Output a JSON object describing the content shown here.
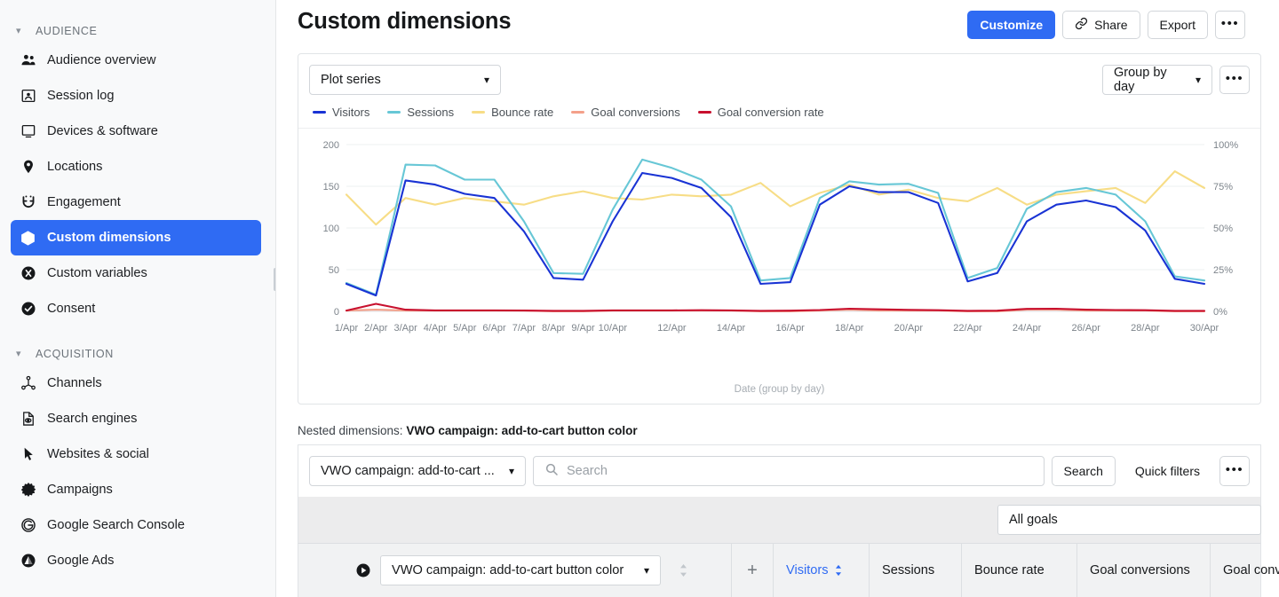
{
  "sidebar": {
    "groups": [
      {
        "name": "AUDIENCE",
        "items": [
          {
            "label": "Audience overview",
            "icon": "users-icon"
          },
          {
            "label": "Session log",
            "icon": "session-log-icon"
          },
          {
            "label": "Devices & software",
            "icon": "device-icon"
          },
          {
            "label": "Locations",
            "icon": "location-pin-icon"
          },
          {
            "label": "Engagement",
            "icon": "magnet-icon"
          },
          {
            "label": "Custom dimensions",
            "icon": "cube-icon",
            "active": true
          },
          {
            "label": "Custom variables",
            "icon": "variable-icon"
          },
          {
            "label": "Consent",
            "icon": "check-circle-icon"
          }
        ]
      },
      {
        "name": "ACQUISITION",
        "items": [
          {
            "label": "Channels",
            "icon": "channels-icon"
          },
          {
            "label": "Search engines",
            "icon": "search-engine-icon"
          },
          {
            "label": "Websites & social",
            "icon": "cursor-icon"
          },
          {
            "label": "Campaigns",
            "icon": "burst-icon"
          },
          {
            "label": "Google Search Console",
            "icon": "google-icon"
          },
          {
            "label": "Google Ads",
            "icon": "google-ads-icon"
          }
        ]
      }
    ]
  },
  "header": {
    "title": "Custom dimensions",
    "customize_label": "Customize",
    "share_label": "Share",
    "export_label": "Export",
    "more_label": "•••"
  },
  "chart_toolbar": {
    "plot_series_label": "Plot series",
    "group_by_label": "Group by day",
    "more_label": "•••"
  },
  "nested": {
    "prefix": "Nested dimensions:",
    "value": "VWO campaign: add-to-cart button color",
    "dimension_select": "VWO campaign: add-to-cart ...",
    "search_placeholder": "Search",
    "search_value": "",
    "search_button": "Search",
    "quick_filters_button": "Quick filters",
    "more_label": "•••"
  },
  "table": {
    "goals_select": "All goals",
    "row_dimension_select": "VWO campaign: add-to-cart button color",
    "plus_label": "+",
    "columns": [
      {
        "label": "Visitors",
        "sorted": true
      },
      {
        "label": "Sessions",
        "sorted": false
      },
      {
        "label": "Bounce rate",
        "sorted": false
      },
      {
        "label": "Goal conversions",
        "sorted": false
      },
      {
        "label": "Goal conversion rate",
        "sorted": false
      }
    ]
  },
  "colors": {
    "accent": "#2f6bf3",
    "visitors": "#1933d4",
    "sessions": "#67c7d6",
    "bounce_rate": "#f7dd86",
    "goal_conversions": "#f4a08a",
    "goal_conversion_rate": "#c8102e"
  },
  "chart_data": {
    "type": "line",
    "title": "",
    "xlabel": "Date (group by day)",
    "ylabel": "",
    "ylim": [
      0,
      200
    ],
    "y2lim": [
      0,
      100
    ],
    "yticks": [
      "0",
      "50",
      "100",
      "150",
      "200"
    ],
    "y2ticks": [
      "0%",
      "25%",
      "50%",
      "75%",
      "100%"
    ],
    "grid": true,
    "legend_position": "top-left",
    "x": [
      "1/Apr",
      "2/Apr",
      "3/Apr",
      "4/Apr",
      "5/Apr",
      "6/Apr",
      "7/Apr",
      "8/Apr",
      "9/Apr",
      "10/Apr",
      "11/Apr",
      "12/Apr",
      "13/Apr",
      "14/Apr",
      "15/Apr",
      "16/Apr",
      "17/Apr",
      "18/Apr",
      "19/Apr",
      "20/Apr",
      "21/Apr",
      "22/Apr",
      "23/Apr",
      "24/Apr",
      "25/Apr",
      "26/Apr",
      "27/Apr",
      "28/Apr",
      "29/Apr",
      "30/Apr"
    ],
    "xticklabels": [
      "1/Apr",
      "2/Apr",
      "3/Apr",
      "4/Apr",
      "5/Apr",
      "6/Apr",
      "7/Apr",
      "8/Apr",
      "9/Apr",
      "10/Apr",
      "",
      "12/Apr",
      "",
      "14/Apr",
      "",
      "16/Apr",
      "",
      "18/Apr",
      "",
      "20/Apr",
      "",
      "22/Apr",
      "",
      "24/Apr",
      "",
      "26/Apr",
      "",
      "28/Apr",
      "",
      "30/Apr"
    ],
    "series": [
      {
        "name": "Visitors",
        "axis": "left",
        "color": "#1933d4",
        "values": [
          33,
          19,
          157,
          152,
          141,
          136,
          96,
          40,
          38,
          108,
          166,
          160,
          148,
          113,
          33,
          35,
          128,
          150,
          143,
          143,
          130,
          36,
          46,
          108,
          128,
          133,
          125,
          97,
          39,
          33
        ]
      },
      {
        "name": "Sessions",
        "axis": "left",
        "color": "#67c7d6",
        "values": [
          34,
          20,
          176,
          175,
          158,
          158,
          108,
          46,
          45,
          122,
          182,
          172,
          158,
          126,
          37,
          40,
          136,
          156,
          152,
          153,
          142,
          40,
          52,
          123,
          143,
          148,
          140,
          108,
          42,
          37
        ]
      },
      {
        "name": "Bounce rate",
        "axis": "right",
        "color": "#f7dd86",
        "values": [
          70,
          52,
          68,
          64,
          68,
          66,
          64,
          69,
          72,
          68,
          67,
          70,
          69,
          70,
          77,
          63,
          71,
          76,
          70,
          73,
          68,
          66,
          74,
          64,
          70,
          72,
          74,
          65,
          84,
          74
        ]
      },
      {
        "name": "Goal conversions",
        "axis": "left",
        "color": "#f4a08a",
        "values": [
          1,
          2,
          1,
          1,
          1,
          1,
          1,
          0,
          0,
          1,
          1,
          1,
          1,
          1,
          0,
          0,
          1,
          2,
          1,
          1,
          1,
          0,
          0,
          2,
          2,
          1,
          1,
          1,
          0,
          0
        ]
      },
      {
        "name": "Goal conversion rate",
        "axis": "right",
        "color": "#c8102e",
        "values": [
          0.5,
          4.5,
          1.0,
          0.6,
          0.6,
          0.6,
          0.5,
          0.3,
          0.3,
          0.6,
          0.6,
          0.6,
          0.7,
          0.6,
          0.3,
          0.4,
          0.8,
          1.6,
          1.2,
          0.9,
          0.7,
          0.3,
          0.4,
          1.5,
          1.6,
          1.0,
          0.8,
          0.7,
          0.3,
          0.3
        ]
      }
    ]
  }
}
